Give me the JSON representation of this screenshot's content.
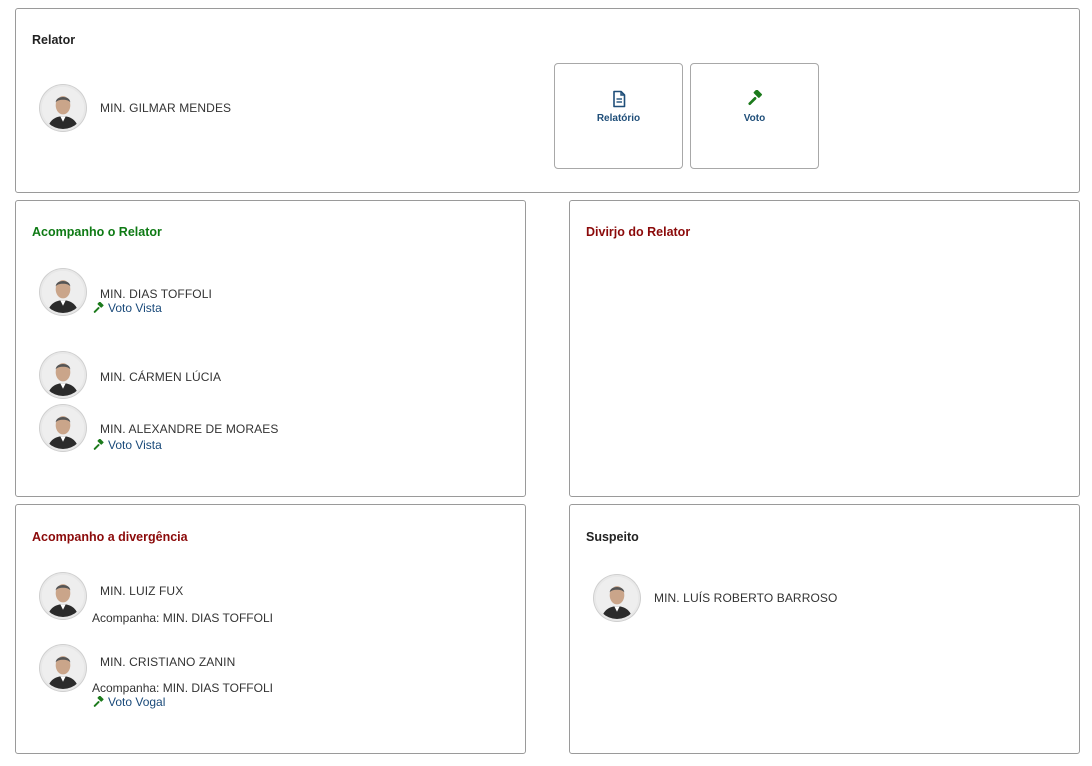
{
  "relator": {
    "title": "Relator",
    "minister": "MIN. GILMAR MENDES",
    "buttons": [
      {
        "label": "Relatório",
        "icon": "document-icon"
      },
      {
        "label": "Voto",
        "icon": "gavel-icon"
      }
    ]
  },
  "acompanho_relator": {
    "title": "Acompanho o Relator",
    "members": [
      {
        "name": "MIN. DIAS TOFFOLI",
        "link": "Voto Vista"
      },
      {
        "name": "MIN. CÁRMEN LÚCIA"
      },
      {
        "name": "MIN. ALEXANDRE DE MORAES",
        "link": "Voto Vista"
      }
    ]
  },
  "divirjo": {
    "title": "Divirjo do Relator"
  },
  "acompanho_divergencia": {
    "title": "Acompanho a divergência",
    "members": [
      {
        "name": "MIN. LUIZ FUX",
        "follows": "Acompanha: MIN. DIAS TOFFOLI"
      },
      {
        "name": "MIN. CRISTIANO ZANIN",
        "follows": "Acompanha: MIN. DIAS TOFFOLI",
        "link": "Voto Vogal"
      }
    ]
  },
  "suspeito": {
    "title": "Suspeito",
    "minister": "MIN. LUÍS ROBERTO BARROSO"
  },
  "colors": {
    "green_heading": "#0e7a14",
    "red_heading": "#8b0a0a",
    "link": "#1a4a7a",
    "gavel": "#1c7a1c",
    "button_text": "#1f4e79"
  }
}
